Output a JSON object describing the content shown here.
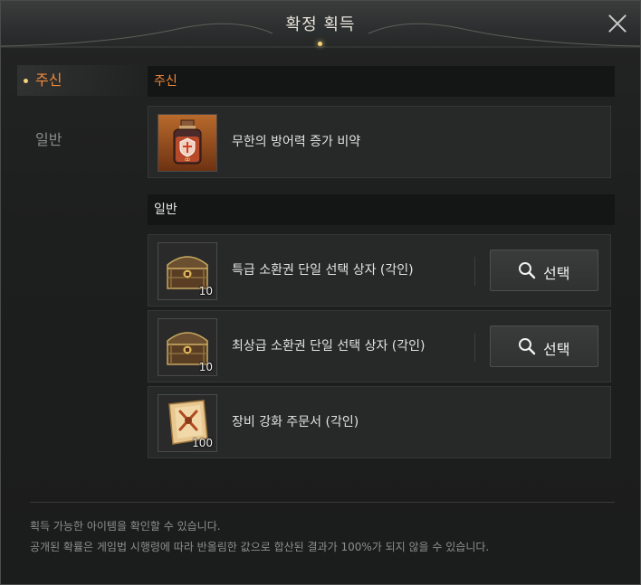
{
  "window": {
    "title": "확정 획득"
  },
  "nav": {
    "items": [
      {
        "label": "주신"
      },
      {
        "label": "일반"
      }
    ]
  },
  "sections": {
    "main_god": {
      "header": "주신",
      "items": [
        {
          "name": "무한의 방어력 증가 비약",
          "icon": "potion-icon"
        }
      ]
    },
    "general": {
      "header": "일반",
      "items": [
        {
          "name": "특급 소환권 단일 선택 상자 (각인)",
          "count": "10",
          "icon": "chest-icon",
          "button": "선택"
        },
        {
          "name": "최상급 소환권 단일 선택 상자 (각인)",
          "count": "10",
          "icon": "chest-icon",
          "button": "선택"
        },
        {
          "name": "장비 강화 주문서 (각인)",
          "count": "100",
          "icon": "scroll-icon"
        }
      ]
    }
  },
  "footer": {
    "line1": "획득 가능한 아이템을 확인할 수 있습니다.",
    "line2": "공개된 확률은 게임법 시행령에 따라 반올림한 값으로 합산된 결과가 100%가 되지 않을 수 있습니다."
  },
  "colors": {
    "accent": "#f08a3a",
    "gold": "#f4d27a",
    "background": "#1b1c1c"
  }
}
